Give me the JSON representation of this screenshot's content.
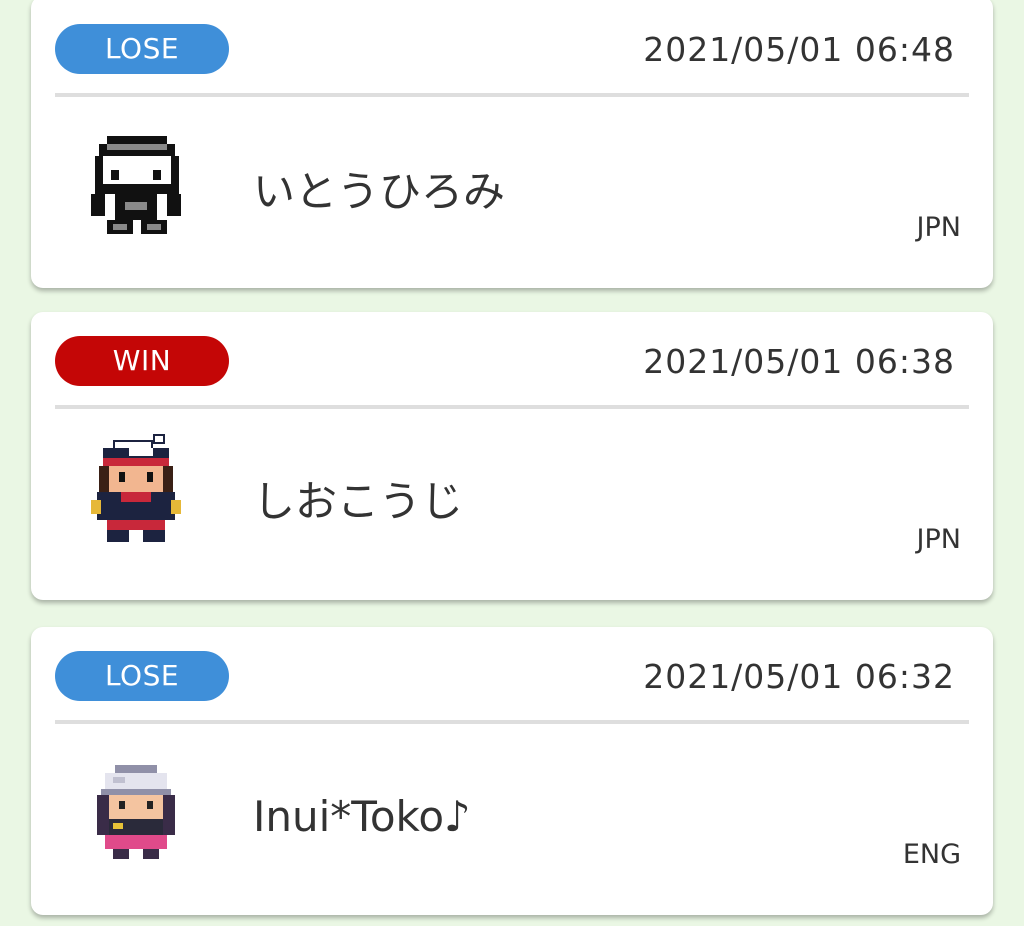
{
  "colors": {
    "lose": "#3f8fd9",
    "win": "#c40606"
  },
  "battles": [
    {
      "result": "LOSE",
      "datetime": "2021/05/01 06:48",
      "player": "いとうひろみ",
      "region": "JPN",
      "avatar_icon": "pixel-trainer-black-white-icon"
    },
    {
      "result": "WIN",
      "datetime": "2021/05/01 06:38",
      "player": "しおこうじ",
      "region": "JPN",
      "avatar_icon": "pixel-trainer-red-cap-icon"
    },
    {
      "result": "LOSE",
      "datetime": "2021/05/01 06:32",
      "player": "Inui*Toko♪",
      "region": "ENG",
      "avatar_icon": "pixel-trainer-white-beanie-icon"
    }
  ]
}
